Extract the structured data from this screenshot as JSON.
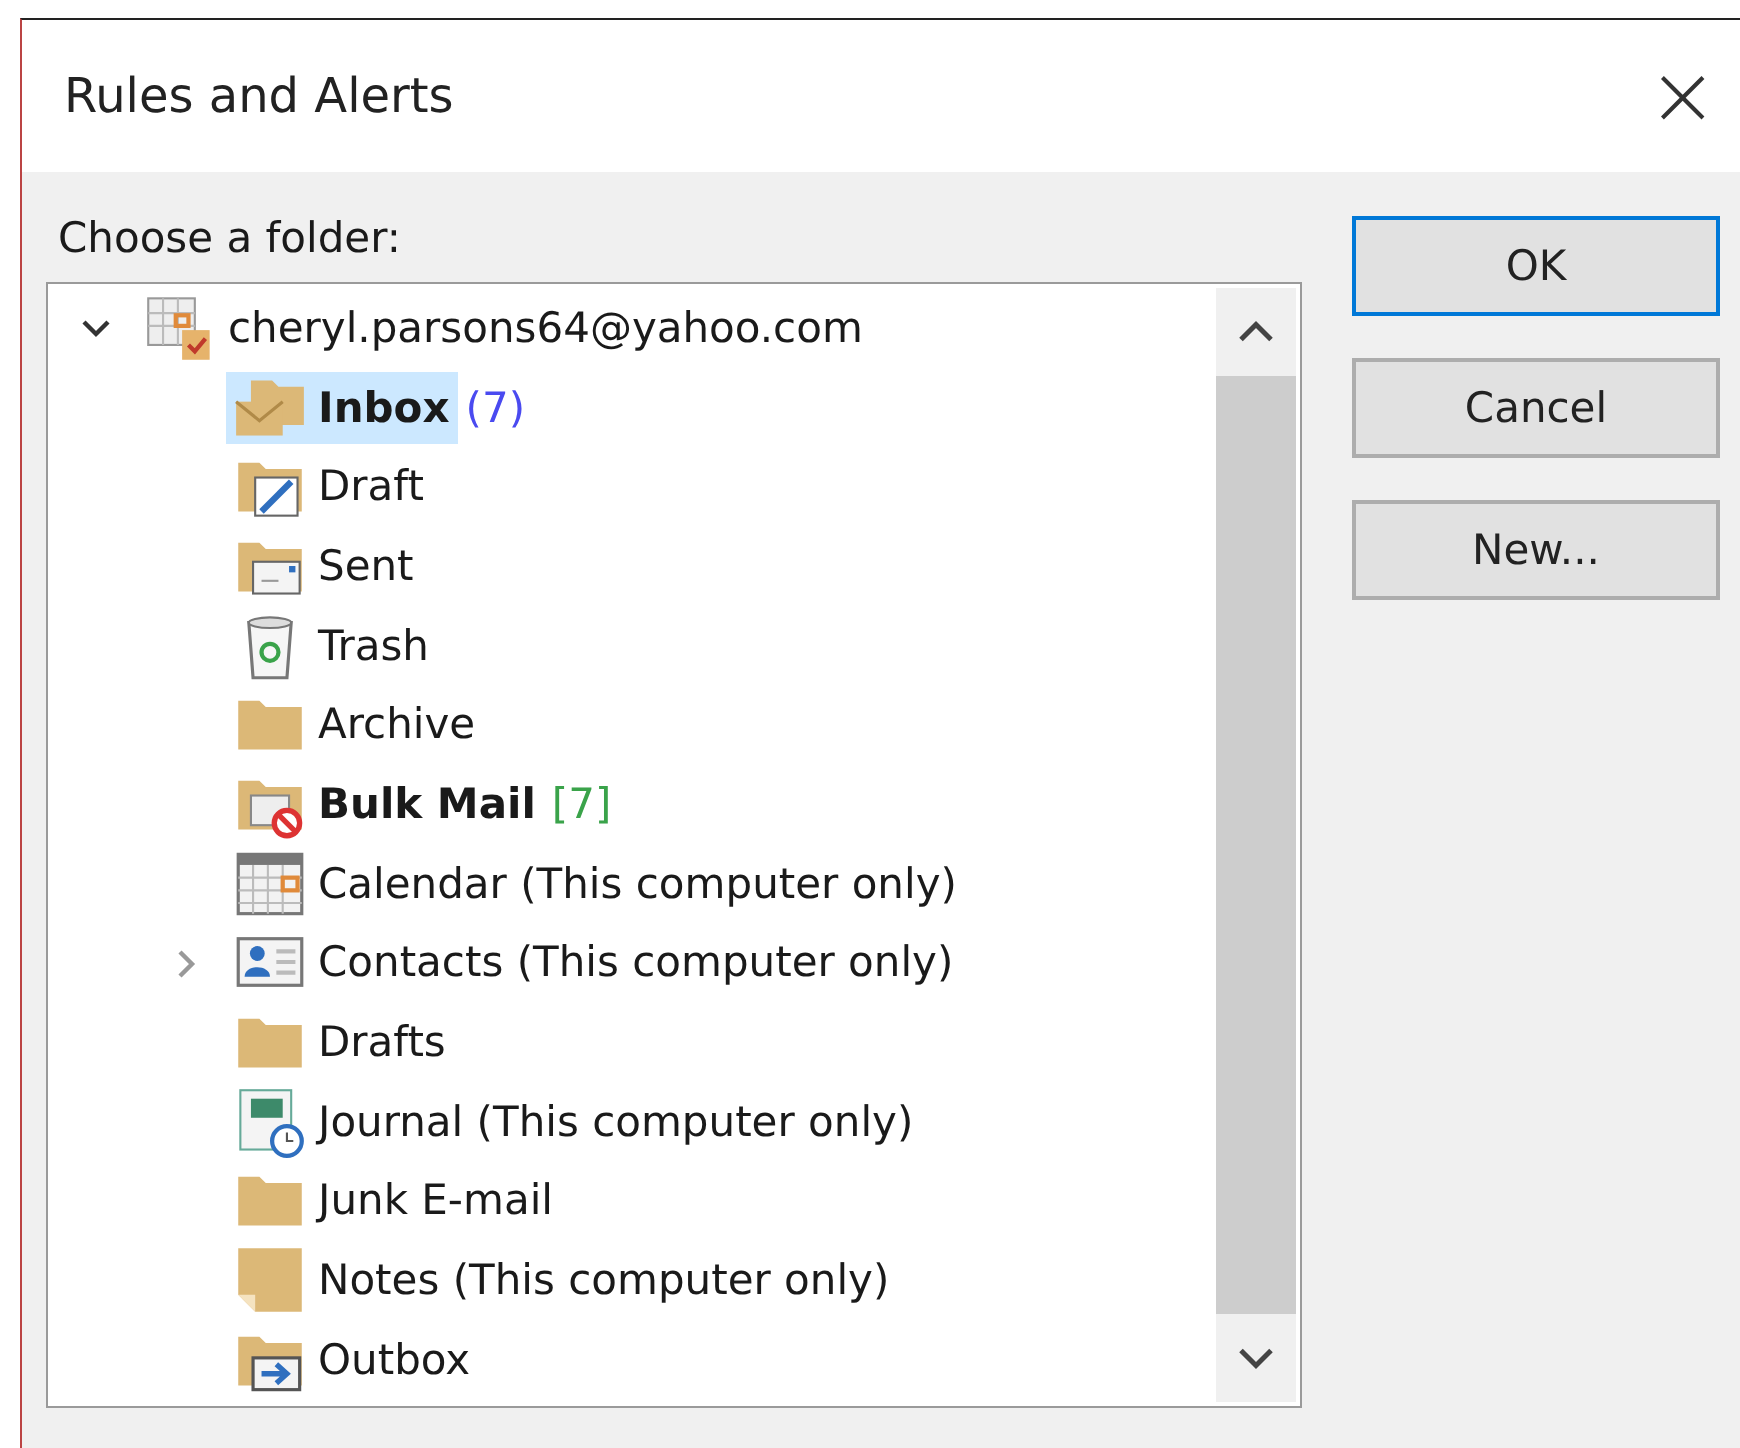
{
  "window": {
    "title": "Rules and Alerts",
    "close": "×"
  },
  "prompt": "Choose a folder:",
  "tree": [
    {
      "label": "cheryl.parsons64@yahoo.com",
      "kind": "account",
      "expanded": true,
      "selected": false,
      "bold": false,
      "children": [
        {
          "label": "Inbox",
          "kind": "inbox",
          "selected": true,
          "bold": true,
          "count": {
            "text": "(7)",
            "color": "#4a4af0"
          }
        },
        {
          "label": "Draft",
          "kind": "draft",
          "selected": false,
          "bold": false
        },
        {
          "label": "Sent",
          "kind": "sent",
          "selected": false,
          "bold": false
        },
        {
          "label": "Trash",
          "kind": "trash",
          "selected": false,
          "bold": false
        },
        {
          "label": "Archive",
          "kind": "folder",
          "selected": false,
          "bold": false
        },
        {
          "label": "Bulk Mail",
          "kind": "bulk",
          "selected": false,
          "bold": true,
          "count": {
            "text": "[7]",
            "color": "#3aa34a"
          }
        },
        {
          "label": "Calendar (This computer only)",
          "kind": "calendar",
          "selected": false,
          "bold": false
        },
        {
          "label": "Contacts (This computer only)",
          "kind": "contacts",
          "expanded": false,
          "selected": false,
          "bold": false
        },
        {
          "label": "Drafts",
          "kind": "folder",
          "selected": false,
          "bold": false
        },
        {
          "label": "Journal (This computer only)",
          "kind": "journal",
          "selected": false,
          "bold": false
        },
        {
          "label": "Junk E-mail",
          "kind": "folder",
          "selected": false,
          "bold": false
        },
        {
          "label": "Notes (This computer only)",
          "kind": "notes",
          "selected": false,
          "bold": false
        },
        {
          "label": "Outbox",
          "kind": "outbox",
          "selected": false,
          "bold": false
        }
      ]
    }
  ],
  "buttons": [
    {
      "label": "OK",
      "default": true
    },
    {
      "label": "Cancel",
      "default": false
    },
    {
      "label": "New...",
      "default": false
    }
  ]
}
